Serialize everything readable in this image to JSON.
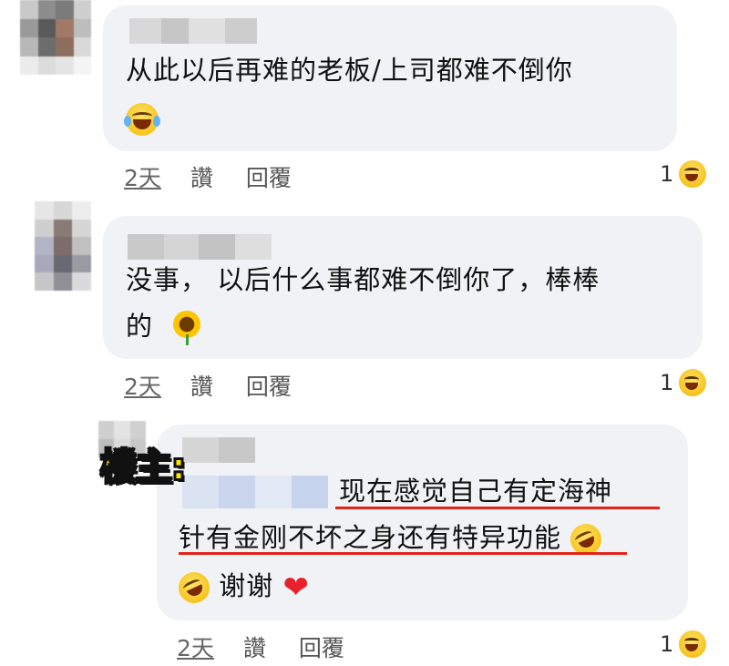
{
  "comments": [
    {
      "text": "从此以后再难的老板/上司都难不倒你",
      "emoji": "grinning-squinting-tears-icon",
      "actions": {
        "time": "2天",
        "like": "讚",
        "reply": "回覆"
      },
      "reaction": {
        "count": "1",
        "icon": "haha-reaction-icon"
      }
    },
    {
      "text_line1": "没事， 以后什么事都难不倒你了，棒棒",
      "text_line2": "的",
      "emoji": "sunflower-icon",
      "actions": {
        "time": "2天",
        "like": "讚",
        "reply": "回覆"
      },
      "reaction": {
        "count": "1",
        "icon": "haha-reaction-icon"
      }
    },
    {
      "op_tag": "楼主:",
      "text_line1": "现在感觉自己有定海神",
      "text_line2": "针有金刚不坏之身还有特异功能",
      "text_line3": "谢谢",
      "emojis": [
        "rofl-icon",
        "rofl-icon",
        "red-heart-icon"
      ],
      "heart": "❤",
      "actions": {
        "time": "2天",
        "like": "讚",
        "reply": "回覆"
      },
      "reaction": {
        "count": "1",
        "icon": "haha-reaction-icon"
      }
    }
  ],
  "colors": {
    "bubble": "#f0f2f5",
    "underline": "#e2231a",
    "op_tag": "#ffe600"
  }
}
